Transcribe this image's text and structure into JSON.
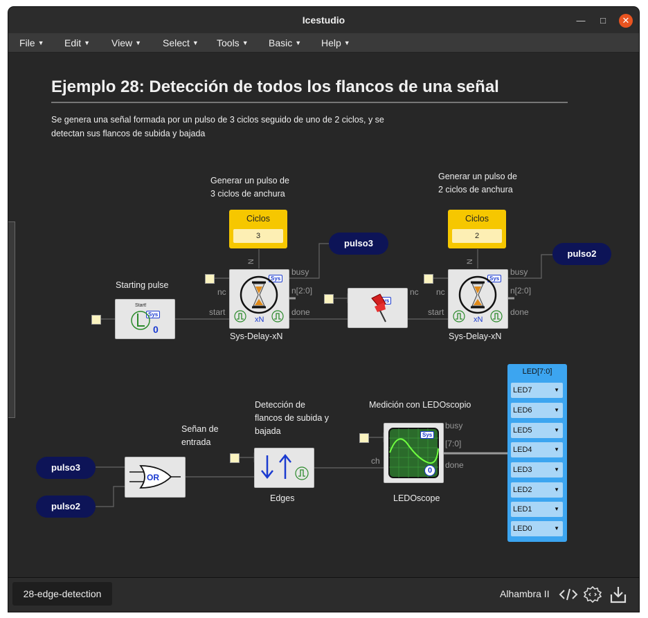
{
  "window": {
    "title": "Icestudio"
  },
  "menu": [
    {
      "label": "File"
    },
    {
      "label": "Edit"
    },
    {
      "label": "View"
    },
    {
      "label": "Select"
    },
    {
      "label": "Tools"
    },
    {
      "label": "Basic"
    },
    {
      "label": "Help"
    }
  ],
  "doc": {
    "title": "Ejemplo 28: Detección de todos los flancos de una señal",
    "description": "Se genera una señal formada por un pulso de 3 ciclos seguido de uno de 2 ciclos, y se detectan sus flancos de subida y bajada"
  },
  "notes": {
    "pulse3_line1": "Generar un pulso de",
    "pulse3_line2": "3 ciclos de anchura",
    "pulse2_line1": "Generar un pulso de",
    "pulse2_line2": "2 ciclos de anchura",
    "starting": "Starting pulse",
    "input_line1": "Señan de",
    "input_line2": "entrada",
    "edges_line1": "Detección de",
    "edges_line2": "flancos de subida y",
    "edges_line3": "bajada",
    "ledoscope": "Medición con LEDOscopio"
  },
  "constants": [
    {
      "title": "Ciclos",
      "value": "3"
    },
    {
      "title": "Ciclos",
      "value": "2"
    }
  ],
  "blocks": {
    "delay1": {
      "label": "Sys-Delay-xN",
      "xn": "xN",
      "sys": "Sys"
    },
    "delay2": {
      "label": "Sys-Delay-xN",
      "xn": "xN",
      "sys": "Sys"
    },
    "start": {
      "start_text": "Start!",
      "zero": "0",
      "sys": "Sys"
    },
    "pin": {
      "sys": "Sys"
    },
    "or": {
      "text": "OR"
    },
    "edges": {
      "label": "Edges"
    },
    "ledoscope": {
      "label": "LEDOscope",
      "zero": "0",
      "sys": "Sys"
    }
  },
  "ports": {
    "busy": "busy",
    "n20": "n[2:0]",
    "done": "done",
    "nc": "nc",
    "start": "start",
    "ch": "ch",
    "bus70": "[7:0]",
    "n": "N"
  },
  "labels": {
    "pulso3": "pulso3",
    "pulso2": "pulso2"
  },
  "led_panel": {
    "title": "LED[7:0]",
    "leds": [
      "LED7",
      "LED6",
      "LED5",
      "LED4",
      "LED3",
      "LED2",
      "LED1",
      "LED0"
    ]
  },
  "footer": {
    "project": "28-edge-detection",
    "board": "Alhambra II"
  },
  "colors": {
    "constant": "#f6c700",
    "label_pill": "#0d1457",
    "led_panel": "#3ca5f0",
    "close_button": "#e95420"
  }
}
